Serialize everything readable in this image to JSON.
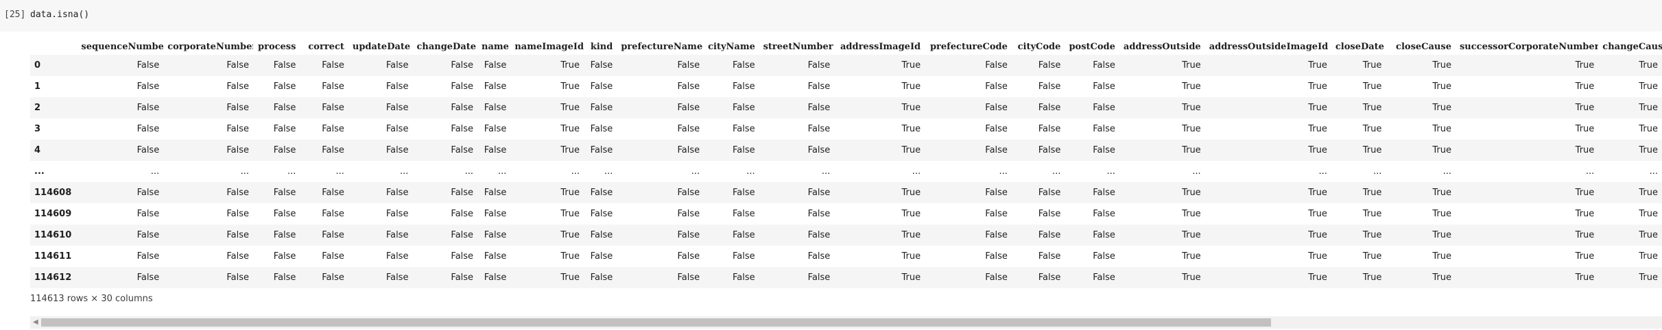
{
  "cell": {
    "prompt": "[25]",
    "code": "data.isna()"
  },
  "table": {
    "columns": [
      "sequenceNumber",
      "corporateNumber",
      "process",
      "correct",
      "updateDate",
      "changeDate",
      "name",
      "nameImageId",
      "kind",
      "prefectureName",
      "cityName",
      "streetNumber",
      "addressImageId",
      "prefectureCode",
      "cityCode",
      "postCode",
      "addressOutside",
      "addressOutsideImageId",
      "closeDate",
      "closeCause",
      "successorCorporateNumber",
      "changeCause"
    ],
    "rows": [
      {
        "index": "0",
        "values": [
          "False",
          "False",
          "False",
          "False",
          "False",
          "False",
          "False",
          "True",
          "False",
          "False",
          "False",
          "False",
          "True",
          "False",
          "False",
          "False",
          "True",
          "True",
          "True",
          "True",
          "True",
          "True"
        ]
      },
      {
        "index": "1",
        "values": [
          "False",
          "False",
          "False",
          "False",
          "False",
          "False",
          "False",
          "True",
          "False",
          "False",
          "False",
          "False",
          "True",
          "False",
          "False",
          "False",
          "True",
          "True",
          "True",
          "True",
          "True",
          "True"
        ]
      },
      {
        "index": "2",
        "values": [
          "False",
          "False",
          "False",
          "False",
          "False",
          "False",
          "False",
          "True",
          "False",
          "False",
          "False",
          "False",
          "True",
          "False",
          "False",
          "False",
          "True",
          "True",
          "True",
          "True",
          "True",
          "True"
        ]
      },
      {
        "index": "3",
        "values": [
          "False",
          "False",
          "False",
          "False",
          "False",
          "False",
          "False",
          "True",
          "False",
          "False",
          "False",
          "False",
          "True",
          "False",
          "False",
          "False",
          "True",
          "True",
          "True",
          "True",
          "True",
          "True"
        ]
      },
      {
        "index": "4",
        "values": [
          "False",
          "False",
          "False",
          "False",
          "False",
          "False",
          "False",
          "True",
          "False",
          "False",
          "False",
          "False",
          "True",
          "False",
          "False",
          "False",
          "True",
          "True",
          "True",
          "True",
          "True",
          "True"
        ]
      },
      {
        "index": "...",
        "values": [
          "...",
          "...",
          "...",
          "...",
          "...",
          "...",
          "...",
          "...",
          "...",
          "...",
          "...",
          "...",
          "...",
          "...",
          "...",
          "...",
          "...",
          "...",
          "...",
          "...",
          "...",
          "..."
        ]
      },
      {
        "index": "114608",
        "values": [
          "False",
          "False",
          "False",
          "False",
          "False",
          "False",
          "False",
          "True",
          "False",
          "False",
          "False",
          "False",
          "True",
          "False",
          "False",
          "False",
          "True",
          "True",
          "True",
          "True",
          "True",
          "True"
        ]
      },
      {
        "index": "114609",
        "values": [
          "False",
          "False",
          "False",
          "False",
          "False",
          "False",
          "False",
          "True",
          "False",
          "False",
          "False",
          "False",
          "True",
          "False",
          "False",
          "False",
          "True",
          "True",
          "True",
          "True",
          "True",
          "True"
        ]
      },
      {
        "index": "114610",
        "values": [
          "False",
          "False",
          "False",
          "False",
          "False",
          "False",
          "False",
          "True",
          "False",
          "False",
          "False",
          "False",
          "True",
          "False",
          "False",
          "False",
          "True",
          "True",
          "True",
          "True",
          "True",
          "True"
        ]
      },
      {
        "index": "114611",
        "values": [
          "False",
          "False",
          "False",
          "False",
          "False",
          "False",
          "False",
          "True",
          "False",
          "False",
          "False",
          "False",
          "True",
          "False",
          "False",
          "False",
          "True",
          "True",
          "True",
          "True",
          "True",
          "True"
        ]
      },
      {
        "index": "114612",
        "values": [
          "False",
          "False",
          "False",
          "False",
          "False",
          "False",
          "False",
          "True",
          "False",
          "False",
          "False",
          "False",
          "True",
          "False",
          "False",
          "False",
          "True",
          "True",
          "True",
          "True",
          "True",
          "True"
        ]
      }
    ],
    "shape_label": "114613 rows × 30 columns"
  },
  "scrollbar": {
    "position_fraction": 0.0,
    "visible_fraction": 0.76
  }
}
